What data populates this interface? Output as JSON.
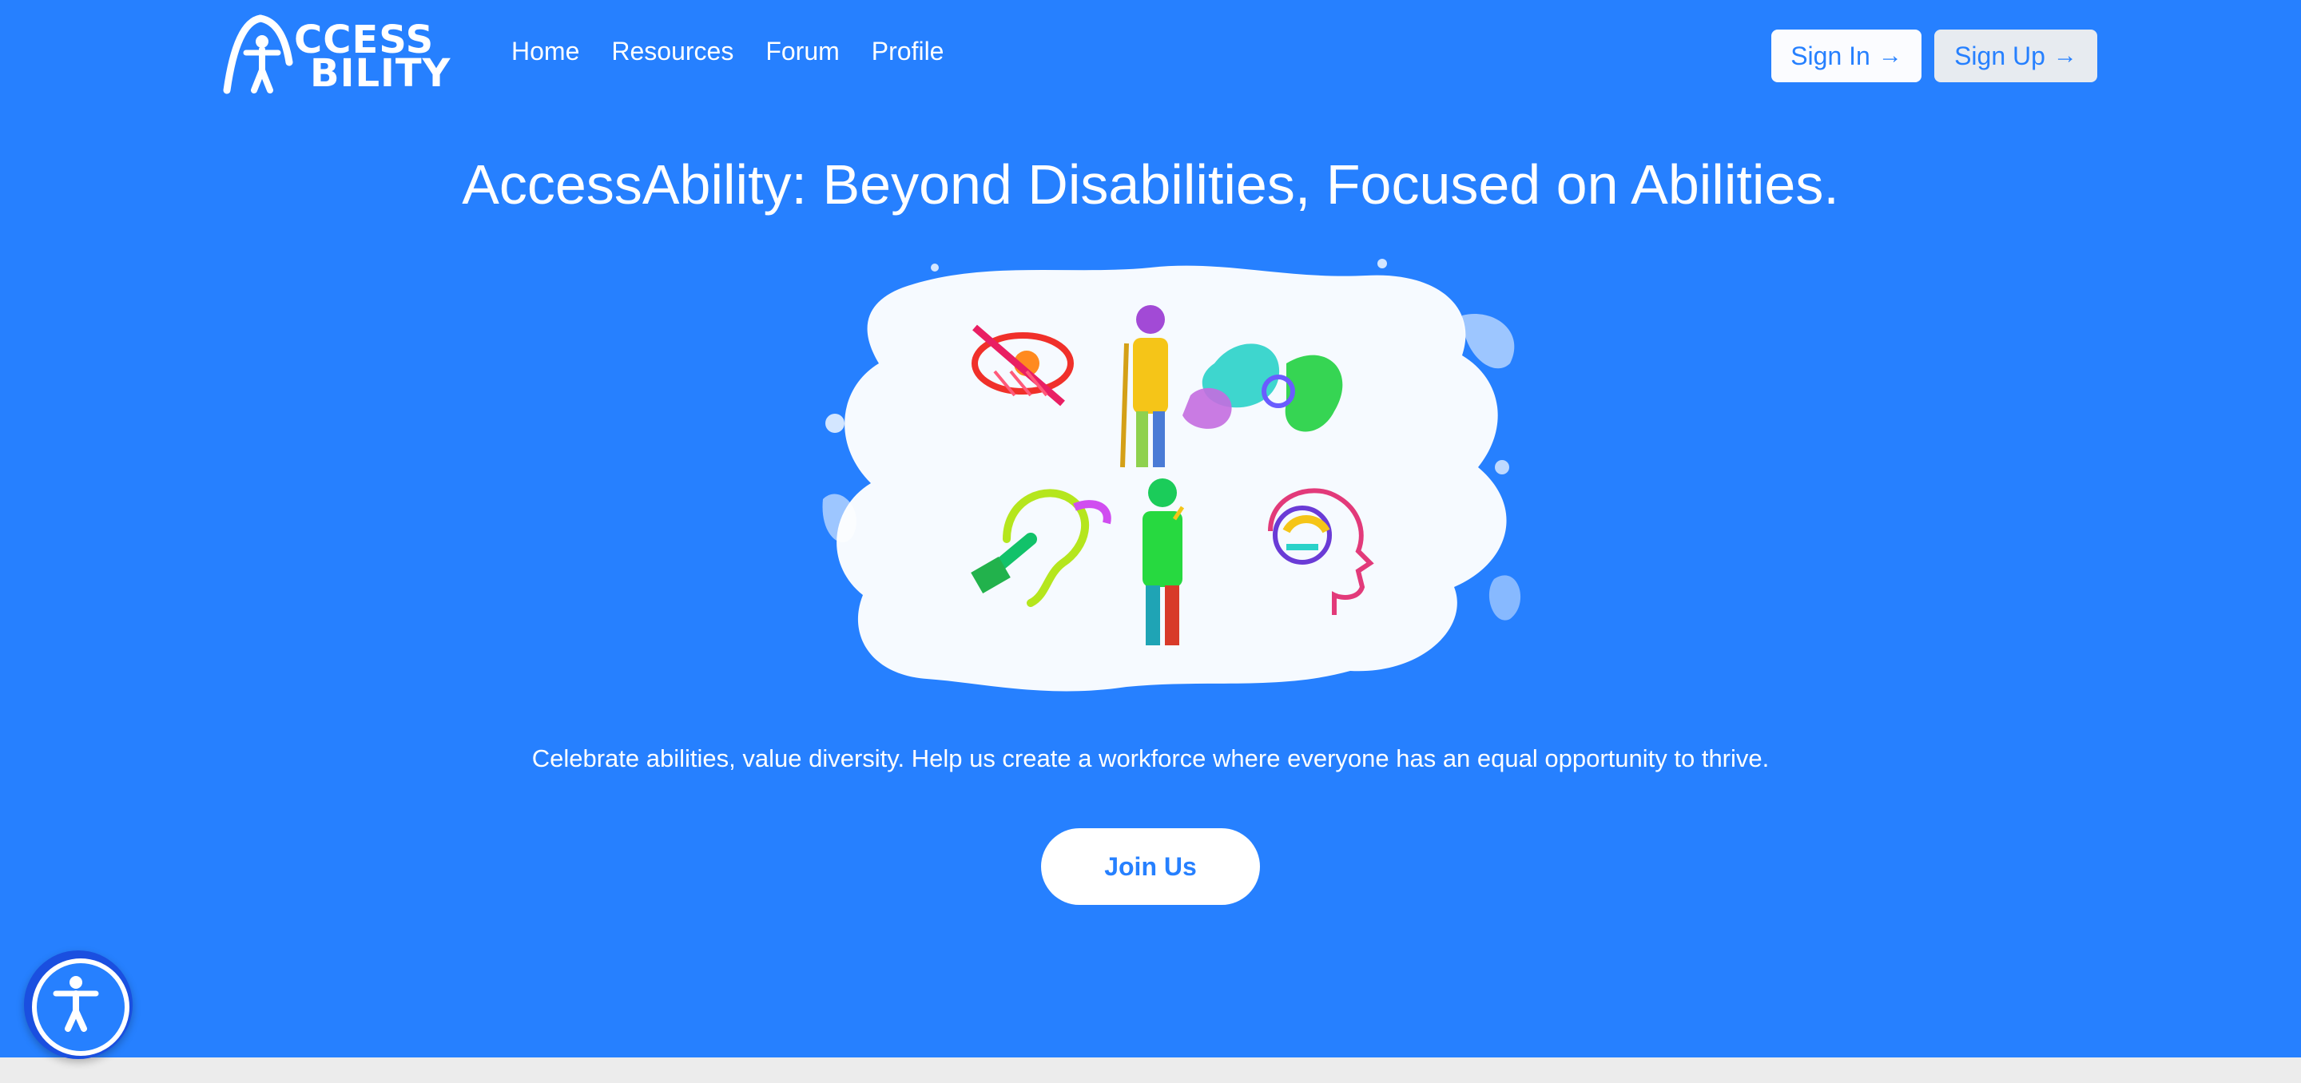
{
  "brand": {
    "logo_line1": "CCESS",
    "logo_line2": "BILITY",
    "logo_icon": "arch-person-icon"
  },
  "nav": {
    "links": [
      "Home",
      "Resources",
      "Forum",
      "Profile"
    ],
    "signin_label": "Sign In",
    "signup_label": "Sign Up",
    "arrow_icon": "arrow-right-icon",
    "arrow_glyph": "→"
  },
  "hero": {
    "headline": "AccessAbility: Beyond Disabilities, Focused on Abilities.",
    "illustration": "colorful-disability-icons-paint-splash",
    "tagline": "Celebrate abilities, value diversity. Help us create a workforce where everyone has an equal opportunity to thrive.",
    "cta_label": "Join Us"
  },
  "widgets": {
    "accessibility_icon": "accessibility-person-icon"
  },
  "colors": {
    "primary": "#2680ff",
    "white": "#ffffff",
    "signup_bg": "#e7ebf0",
    "widget_dark": "#1a4fe0"
  }
}
